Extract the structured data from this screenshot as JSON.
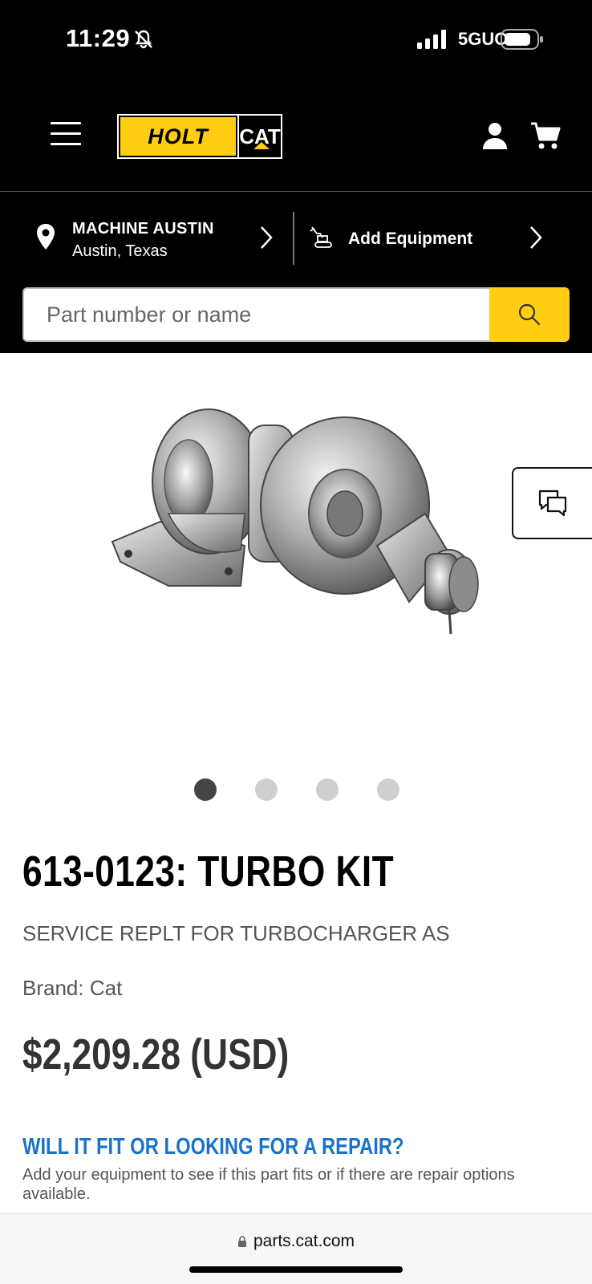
{
  "status_bar": {
    "time": "11:29",
    "network": "5GUC"
  },
  "header": {
    "logo_holt": "HOLT",
    "logo_cat": "CAT"
  },
  "location": {
    "name": "MACHINE AUSTIN",
    "city": "Austin, Texas"
  },
  "equipment": {
    "label": "Add Equipment"
  },
  "search": {
    "placeholder": "Part number or name"
  },
  "gallery": {
    "dot_count": 4,
    "active_index": 0
  },
  "product": {
    "title": "613-0123: TURBO KIT",
    "description": "SERVICE REPLT FOR TURBOCHARGER AS",
    "brand": "Brand: Cat",
    "price": "$2,209.28 (USD)"
  },
  "fit": {
    "title": "WILL IT FIT OR LOOKING FOR A REPAIR?",
    "text": "Add your equipment to see if this part fits or if there are repair options available."
  },
  "browser": {
    "url": "parts.cat.com"
  },
  "colors": {
    "brand_yellow": "#ffcd11",
    "link_blue": "#1a73c8",
    "header_black": "#000000"
  }
}
